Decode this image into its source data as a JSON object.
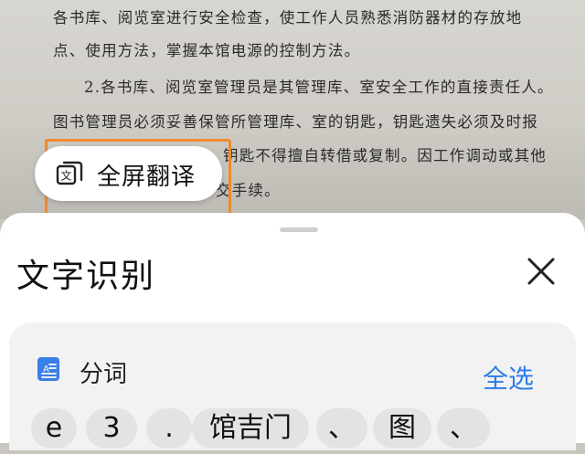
{
  "document": {
    "lines": [
      "各书库、阅览室进行安全检查，使工作人员熟悉消防器材的存放地",
      "点、使用方法，掌握本馆电源的控制方法。",
      "2.各书库、阅览室管理员是其管理库、室安全工作的直接责任人。",
      "图书管理员必须妥善保管所管理库、室的钥匙，钥匙遗失必须及时报",
      "钥匙不得擅自转借或复制。因工作调动或其他",
      "交手续。"
    ]
  },
  "floating_button": {
    "label": "全屏翻译",
    "icon": "translate-icon"
  },
  "sheet": {
    "title": "文字识别",
    "close_icon": "close-icon",
    "segment": {
      "icon": "document-icon",
      "label": "分词",
      "select_all": "全选"
    },
    "chips": [
      "e",
      "3",
      ".",
      "馆吉门",
      "、",
      "图",
      "、"
    ]
  },
  "colors": {
    "accent": "#2b7de9",
    "highlight": "#f08a2a"
  }
}
